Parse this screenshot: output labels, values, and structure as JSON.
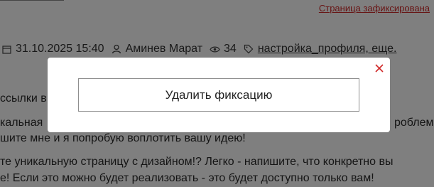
{
  "header": {
    "fixed_link": "Страница зафиксирована"
  },
  "meta": {
    "date": "31.10.2025 15:40",
    "author": "Аминев Марат",
    "views": "34",
    "tags": "настройка_профиля, еще."
  },
  "content": {
    "lines": [
      "ссылки в",
      "кальная",
      "шите мне и я попробую воплотить вашу идею!",
      "те уникальную страницу с дизайном!? Легко - напишите, что конкретно вы",
      "е! Если это можно будет реализовать - это будет доступно только вам!"
    ],
    "partial_right": "роблем"
  },
  "modal": {
    "action_label": "Удалить фиксацию",
    "close_icon": "close-icon",
    "close_color": "#d02929"
  },
  "colors": {
    "link_red": "#d02929",
    "overlay": "rgba(0,0,0,0.5)"
  }
}
